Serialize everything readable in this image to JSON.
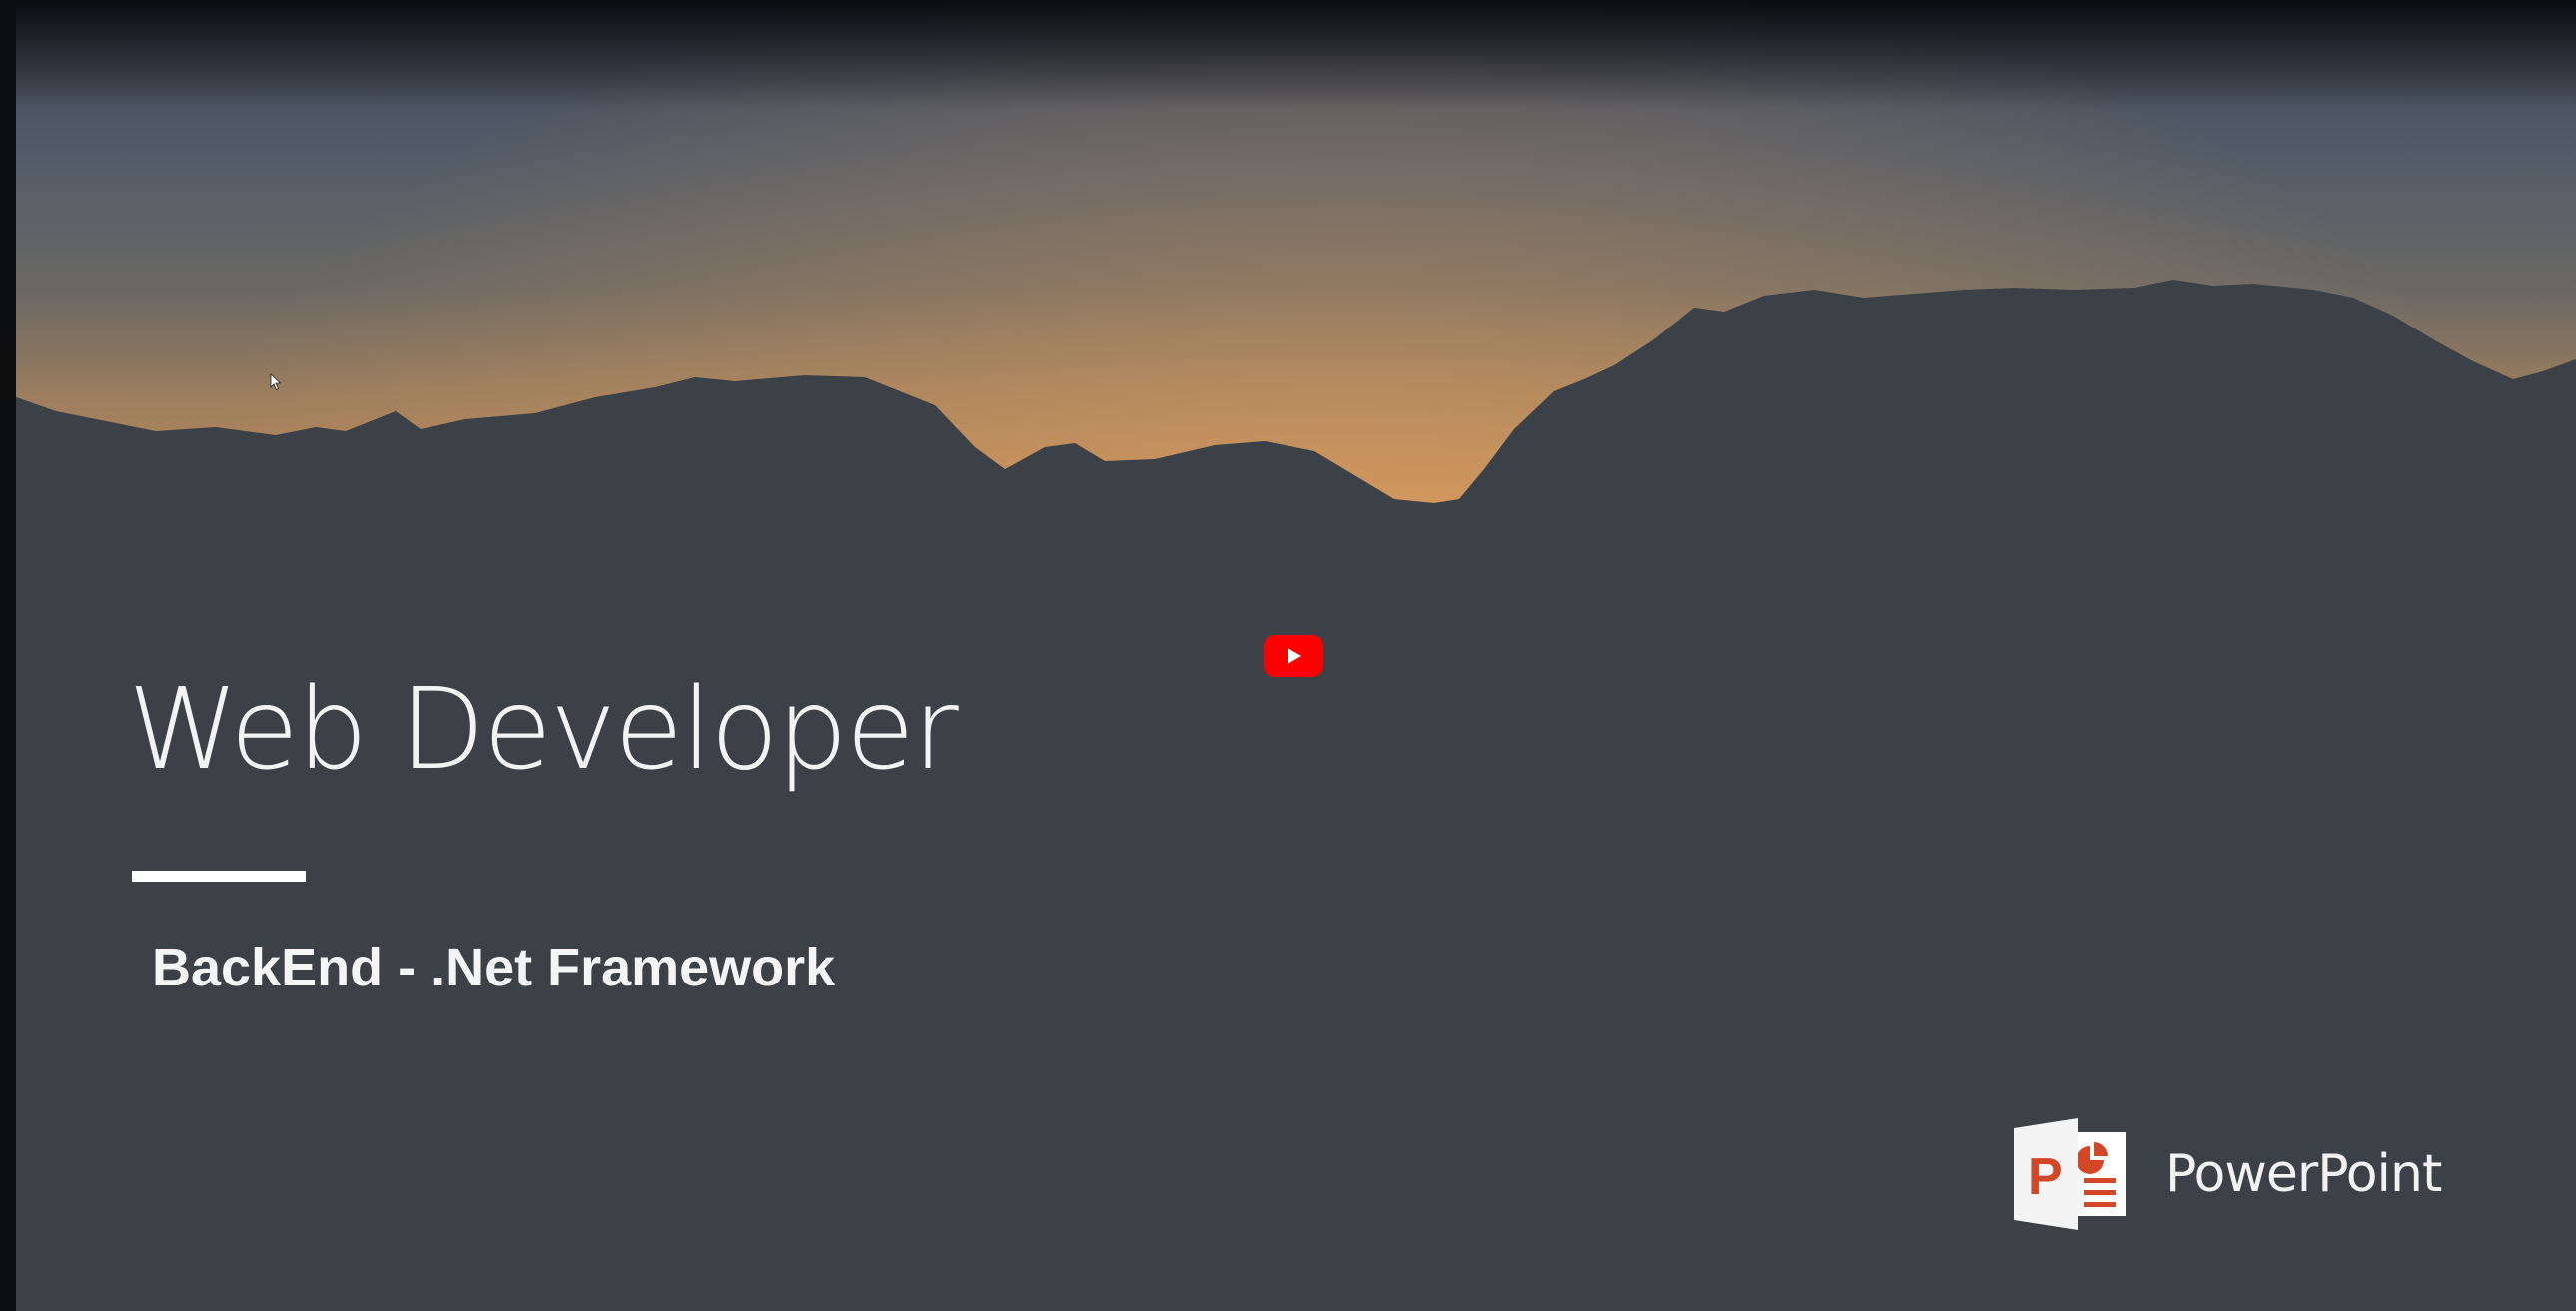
{
  "slide": {
    "title": "Web Developer",
    "subtitle": "BackEnd - .Net Framework"
  },
  "player": {
    "play_icon": "play-icon",
    "accent_color": "#ff0000"
  },
  "branding": {
    "app_name": "PowerPoint",
    "logo_icon": "powerpoint-logo-icon",
    "logo_letter": "P",
    "brand_color": "#d24726"
  },
  "icons": {
    "cursor": "mouse-pointer-icon"
  }
}
